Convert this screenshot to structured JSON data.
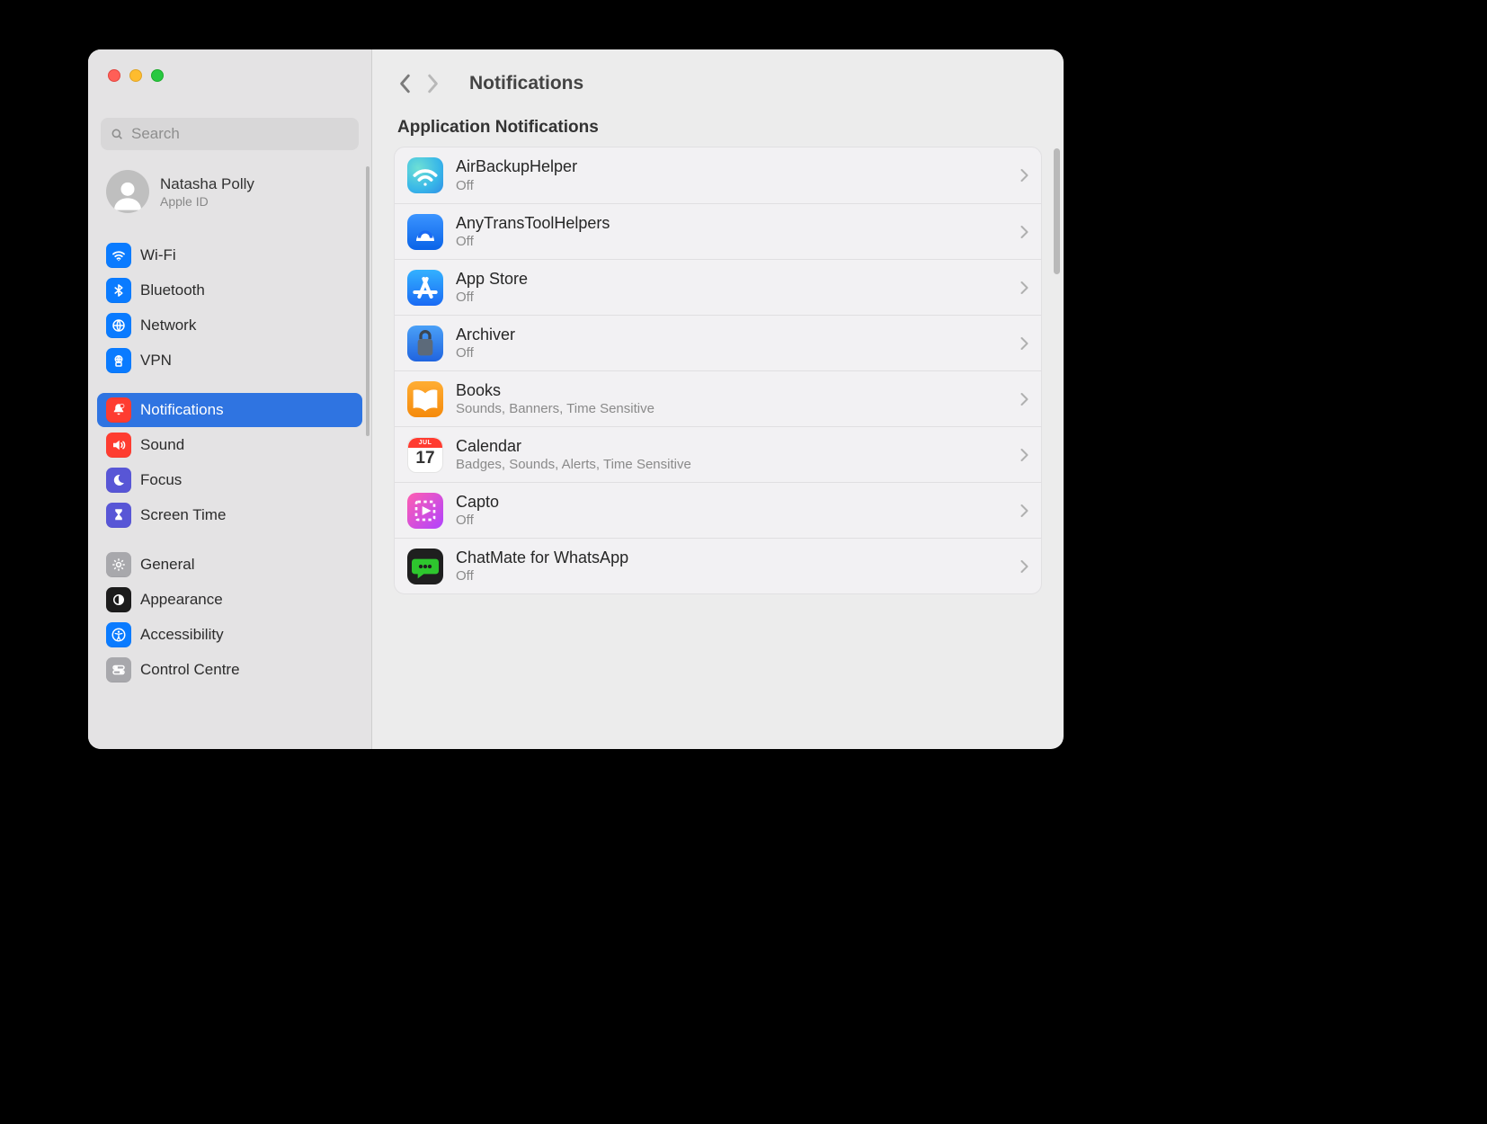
{
  "header": {
    "title": "Notifications"
  },
  "search": {
    "placeholder": "Search"
  },
  "profile": {
    "name": "Natasha Polly",
    "sub": "Apple ID"
  },
  "sidebar": {
    "groups": [
      [
        {
          "id": "wifi",
          "label": "Wi-Fi"
        },
        {
          "id": "bluetooth",
          "label": "Bluetooth"
        },
        {
          "id": "network",
          "label": "Network"
        },
        {
          "id": "vpn",
          "label": "VPN"
        }
      ],
      [
        {
          "id": "notifications",
          "label": "Notifications"
        },
        {
          "id": "sound",
          "label": "Sound"
        },
        {
          "id": "focus",
          "label": "Focus"
        },
        {
          "id": "screentime",
          "label": "Screen Time"
        }
      ],
      [
        {
          "id": "general",
          "label": "General"
        },
        {
          "id": "appearance",
          "label": "Appearance"
        },
        {
          "id": "accessibility",
          "label": "Accessibility"
        },
        {
          "id": "controlcentre",
          "label": "Control Centre"
        }
      ]
    ]
  },
  "section_title": "Application Notifications",
  "apps": [
    {
      "name": "AirBackupHelper",
      "sub": "Off"
    },
    {
      "name": "AnyTransToolHelpers",
      "sub": "Off"
    },
    {
      "name": "App Store",
      "sub": "Off"
    },
    {
      "name": "Archiver",
      "sub": "Off"
    },
    {
      "name": "Books",
      "sub": "Sounds, Banners, Time Sensitive"
    },
    {
      "name": "Calendar",
      "sub": "Badges, Sounds, Alerts, Time Sensitive"
    },
    {
      "name": "Capto",
      "sub": "Off"
    },
    {
      "name": "ChatMate for WhatsApp",
      "sub": "Off"
    }
  ],
  "calendar_icon": {
    "month": "JUL",
    "day": "17"
  }
}
